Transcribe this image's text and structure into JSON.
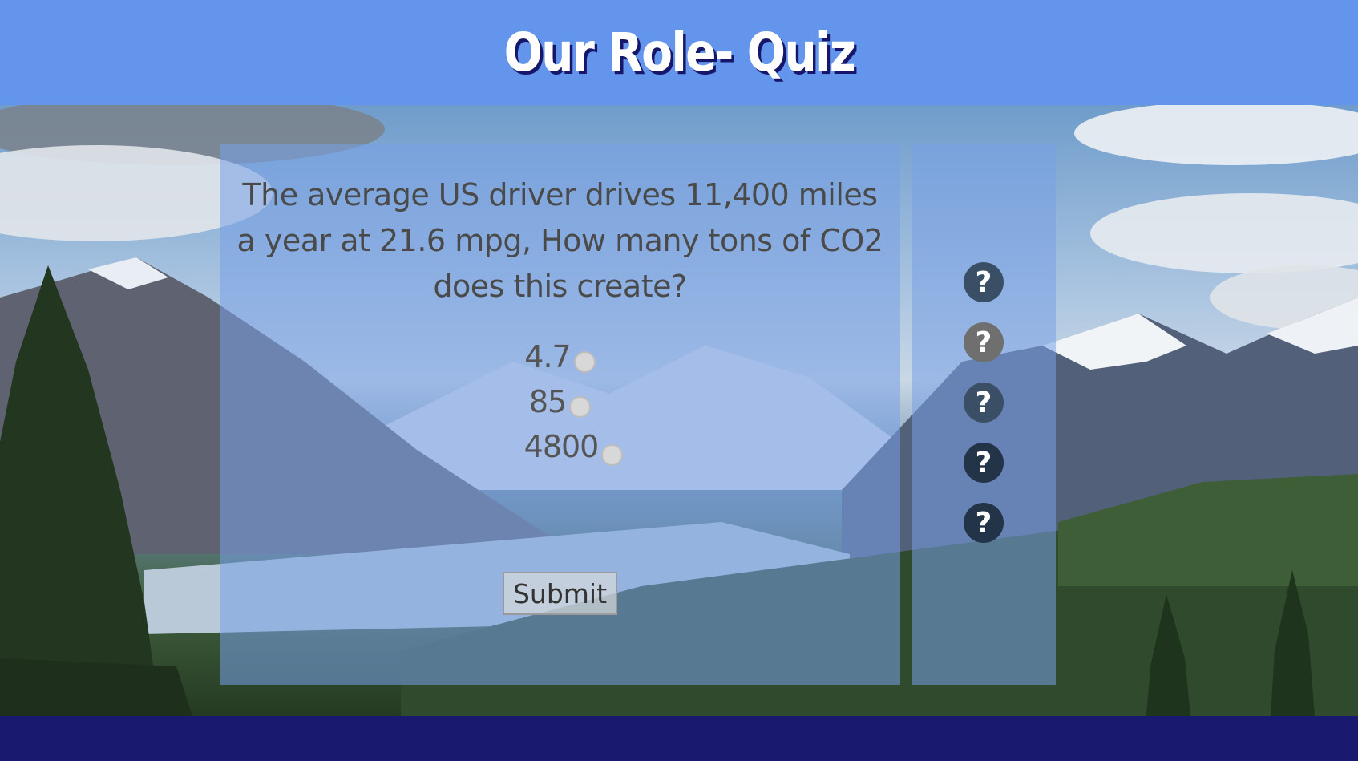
{
  "header": {
    "title": "Our Role- Quiz"
  },
  "question": {
    "text": "The average US driver drives 11,400 miles a year at 21.6 mpg, How many tons of CO2 does this create?",
    "options": [
      "4.7",
      "85",
      "4800"
    ]
  },
  "submit": {
    "label": "Submit"
  },
  "progress": {
    "icons": [
      "?",
      "?",
      "?",
      "?",
      "?"
    ],
    "icon_name": "question-mark-icon"
  },
  "colors": {
    "header_bg": "#6495ed",
    "footer_bg": "#191970",
    "title_shadow": "#16166a",
    "panel_overlay": "rgba(120,160,230,0.55)"
  }
}
